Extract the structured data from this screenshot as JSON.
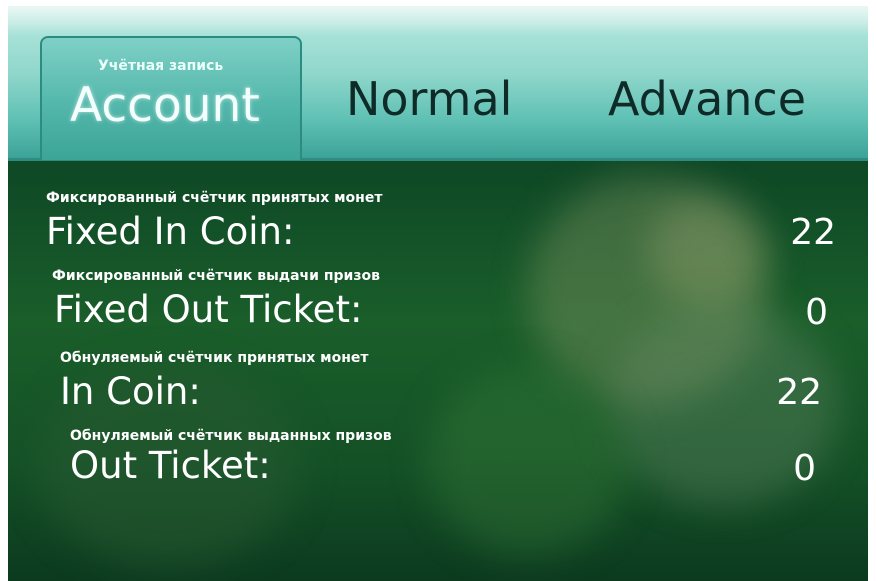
{
  "tabs": {
    "account": {
      "label": "Account",
      "sublabel": "Учётная запись",
      "active": true
    },
    "normal": {
      "label": "Normal"
    },
    "advance": {
      "label": "Advance"
    }
  },
  "counters": [
    {
      "caption": "Фиксированный счётчик принятых монет",
      "label": "Fixed In Coin:",
      "value": "22"
    },
    {
      "caption": "Фиксированный счётчик выдачи призов",
      "label": "Fixed Out Ticket:",
      "value": "0"
    },
    {
      "caption": "Обнуляемый счётчик принятых монет",
      "label": "In Coin:",
      "value": "22"
    },
    {
      "caption": "Обнуляемый счётчик выданных призов",
      "label": "Out Ticket:",
      "value": "0"
    }
  ],
  "colors": {
    "tab_bar": "#8fd6cb",
    "active_tab": "#53b7ab",
    "background": "#0f4a26",
    "text": "#ffffff"
  }
}
